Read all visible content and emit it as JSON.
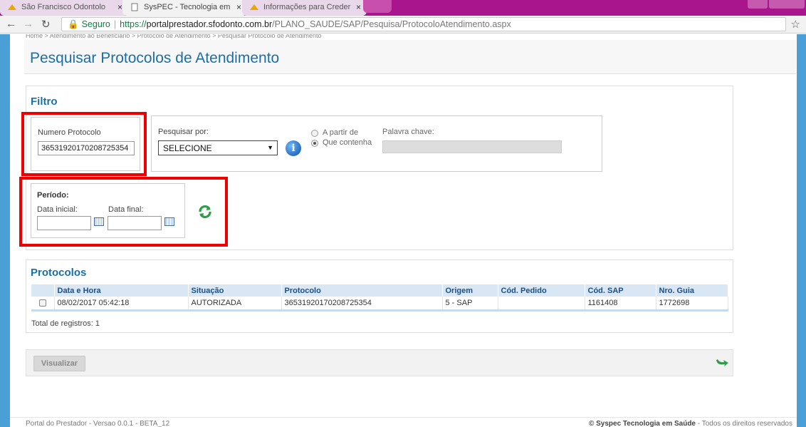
{
  "browser": {
    "tabs": [
      {
        "label": "São Francisco Odontolo",
        "active": false
      },
      {
        "label": "SysPEC - Tecnologia em",
        "active": true
      },
      {
        "label": "Informações para Creder",
        "active": false
      }
    ],
    "url": {
      "secure_label": "Seguro",
      "protocol": "https://",
      "host": "portalprestador.sfodonto.com.br",
      "path": "/PLANO_SAUDE/SAP/Pesquisa/ProtocoloAtendimento.aspx"
    }
  },
  "breadcrumb": "Home   > Atendimento ao Beneficiário   > Protocolo de Atendimento   > Pesquisar Protocolo de Atendimento",
  "page_title": "Pesquisar Protocolos de Atendimento",
  "filtro": {
    "title": "Filtro",
    "numero_protocolo_label": "Numero Protocolo",
    "numero_protocolo_value": "36531920170208725354",
    "pesquisar_por_label": "Pesquisar por:",
    "pesquisar_por_value": "SELECIONE",
    "radio_a_partir_de": "A partir de",
    "radio_que_contenha": "Que contenha",
    "radio_selected": "Que contenha",
    "palavra_chave_label": "Palavra chave:",
    "periodo_label": "Período:",
    "data_inicial_label": "Data inicial:",
    "data_final_label": "Data final:"
  },
  "protocolos": {
    "title": "Protocolos",
    "columns": [
      "Data e Hora",
      "Situação",
      "Protocolo",
      "Origem",
      "Cód. Pedido",
      "Cód. SAP",
      "Nro. Guia"
    ],
    "rows": [
      [
        "08/02/2017 05:42:18",
        "AUTORIZADA",
        "36531920170208725354",
        "5 - SAP",
        "",
        "1161408",
        "1772698"
      ]
    ],
    "total_label": "Total de registros: 1"
  },
  "actions": {
    "visualizar_label": "Visualizar"
  },
  "footer": {
    "left": "Portal do Prestador - Versao 0.0.1 - BETA_12",
    "right_bold": "© Syspec Tecnologia em Saúde",
    "right_rest": " - Todos os direitos reservados"
  },
  "colors": {
    "tab_bar": "#a8158c",
    "frame_blue": "#4a9fd6",
    "title_blue": "#1b6fa8",
    "highlight_red": "#ee0000",
    "refresh_green": "#2e9d4a"
  },
  "icons": [
    "back-arrow-icon",
    "forward-arrow-icon",
    "reload-icon",
    "lock-icon",
    "star-icon",
    "info-icon",
    "calendar-icon",
    "refresh-icon",
    "return-icon"
  ]
}
